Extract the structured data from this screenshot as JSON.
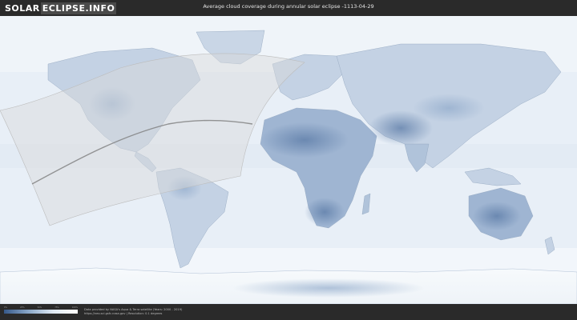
{
  "logo": {
    "part1": "SOLAR",
    "part2": "ECLIPSE.INFO"
  },
  "title": "Average cloud coverage during annular solar eclipse -1113-04-29",
  "legend": {
    "ticks": [
      "0%",
      "25%",
      "50%",
      "75%",
      "100%"
    ],
    "colors": [
      "#36598a",
      "#8aa7c8",
      "#dfe9f3",
      "#ffffff"
    ]
  },
  "credit": {
    "line1": "Data provided by NASA's Aqua & Terra satellite (Years: 2000 - 2019)",
    "line2": "https://neo.sci.gsfc.nasa.gov | Resolution: 0.1 degrees"
  },
  "map": {
    "ocean_color": "#eaf1f8",
    "cloud_dense_color": "#5a7aa6",
    "eclipse_zone_color": "#d9d9d9"
  }
}
